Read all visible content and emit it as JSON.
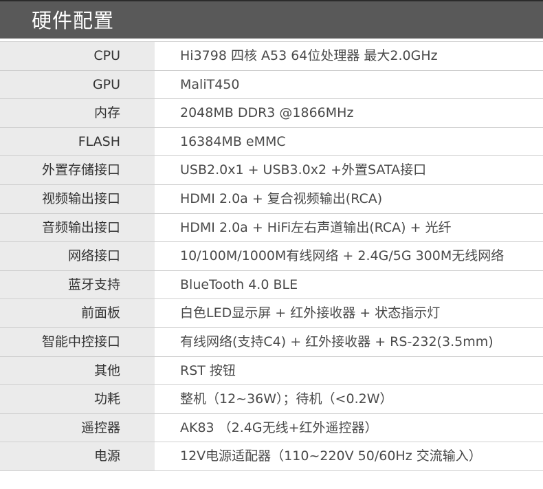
{
  "header": {
    "title": "硬件配置"
  },
  "colors": {
    "header_bg": "#595959",
    "label_bg": "#ebebeb",
    "border": "#cfcfcf"
  },
  "rows": [
    {
      "label": "CPU",
      "value": "Hi3798 四核 A53 64位处理器 最大2.0GHz"
    },
    {
      "label": "GPU",
      "value": "MaliT450"
    },
    {
      "label": "内存",
      "value": "2048MB DDR3 @1866MHz"
    },
    {
      "label": "FLASH",
      "value": "16384MB eMMC"
    },
    {
      "label": "外置存储接口",
      "value": "USB2.0x1 + USB3.0x2 +外置SATA接口"
    },
    {
      "label": "视频输出接口",
      "value": "HDMI 2.0a + 复合视频输出(RCA)"
    },
    {
      "label": "音频输出接口",
      "value": "HDMI 2.0a + HiFi左右声道输出(RCA) + 光纤"
    },
    {
      "label": "网络接口",
      "value": "10/100M/1000M有线网络 + 2.4G/5G 300M无线网络"
    },
    {
      "label": "蓝牙支持",
      "value": "BlueTooth 4.0 BLE"
    },
    {
      "label": "前面板",
      "value": "白色LED显示屏 + 红外接收器 + 状态指示灯"
    },
    {
      "label": "智能中控接口",
      "value": "有线网络(支持C4) + 红外接收器 + RS-232(3.5mm)"
    },
    {
      "label": "其他",
      "value": "RST 按钮"
    },
    {
      "label": "功耗",
      "value": "整机（12~36W）；待机（<0.2W）"
    },
    {
      "label": "遥控器",
      "value": "AK83 （2.4G无线+红外遥控器）"
    },
    {
      "label": "电源",
      "value": "12V电源适配器（110~220V 50/60Hz 交流输入）"
    }
  ]
}
